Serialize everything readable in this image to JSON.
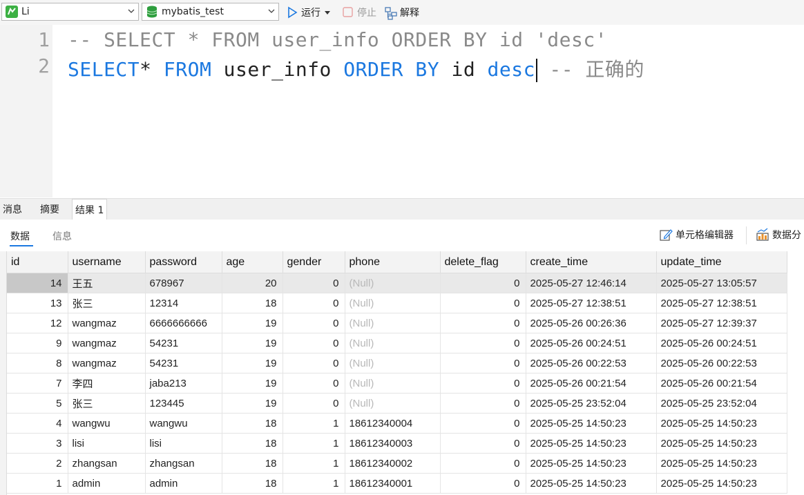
{
  "toolbar": {
    "connection": "Li",
    "database": "mybatis_test",
    "run_label": "运行",
    "stop_label": "停止",
    "explain_label": "解释"
  },
  "editor": {
    "line_numbers": [
      "1",
      "2"
    ],
    "line1": "-- SELECT * FROM user_info ORDER BY id 'desc'",
    "line2": {
      "kw_select": "SELECT",
      "star": "*",
      "kw_from": "FROM",
      "table": "user_info",
      "kw_order_by": "ORDER BY",
      "col": "id",
      "kw_desc": "desc",
      "comment": "-- 正确的"
    }
  },
  "tabs": [
    "消息",
    "摘要",
    "结果 1"
  ],
  "subtabs": [
    "数据",
    "信息"
  ],
  "right_tools": {
    "cell_editor": "单元格编辑器",
    "data_analysis": "数据分"
  },
  "table": {
    "columns": [
      "id",
      "username",
      "password",
      "age",
      "gender",
      "phone",
      "delete_flag",
      "create_time",
      "update_time"
    ],
    "rows": [
      [
        "14",
        "王五",
        "678967",
        "20",
        "0",
        "(Null)",
        "0",
        "2025-05-27 12:46:14",
        "2025-05-27 13:05:57"
      ],
      [
        "13",
        "张三",
        "12314",
        "18",
        "0",
        "(Null)",
        "0",
        "2025-05-27 12:38:51",
        "2025-05-27 12:38:51"
      ],
      [
        "12",
        "wangmaz",
        "6666666666",
        "19",
        "0",
        "(Null)",
        "0",
        "2025-05-26 00:26:36",
        "2025-05-27 12:39:37"
      ],
      [
        "9",
        "wangmaz",
        "54231",
        "19",
        "0",
        "(Null)",
        "0",
        "2025-05-26 00:24:51",
        "2025-05-26 00:24:51"
      ],
      [
        "8",
        "wangmaz",
        "54231",
        "19",
        "0",
        "(Null)",
        "0",
        "2025-05-26 00:22:53",
        "2025-05-26 00:22:53"
      ],
      [
        "7",
        "李四",
        "jaba213",
        "19",
        "0",
        "(Null)",
        "0",
        "2025-05-26 00:21:54",
        "2025-05-26 00:21:54"
      ],
      [
        "5",
        "张三",
        "123445",
        "19",
        "0",
        "(Null)",
        "0",
        "2025-05-25 23:52:04",
        "2025-05-25 23:52:04"
      ],
      [
        "4",
        "wangwu",
        "wangwu",
        "18",
        "1",
        "18612340004",
        "0",
        "2025-05-25 14:50:23",
        "2025-05-25 14:50:23"
      ],
      [
        "3",
        "lisi",
        "lisi",
        "18",
        "1",
        "18612340003",
        "0",
        "2025-05-25 14:50:23",
        "2025-05-25 14:50:23"
      ],
      [
        "2",
        "zhangsan",
        "zhangsan",
        "18",
        "1",
        "18612340002",
        "0",
        "2025-05-25 14:50:23",
        "2025-05-25 14:50:23"
      ],
      [
        "1",
        "admin",
        "admin",
        "18",
        "1",
        "18612340001",
        "0",
        "2025-05-25 14:50:23",
        "2025-05-25 14:50:23"
      ]
    ]
  },
  "colors": {
    "keyword": "#1b78e0",
    "comment": "#8a8a8a",
    "null_text": "#b8b8b8",
    "run_icon": "#1b78e0",
    "connection_icon": "#3cb043",
    "database_icon": "#2e9e3e"
  },
  "icons": {
    "connection": "mysql-connection-icon",
    "database": "database-icon",
    "run": "play-icon",
    "stop": "stop-icon",
    "explain": "explain-icon",
    "cell_editor": "edit-icon",
    "data_analysis": "chart-icon"
  }
}
